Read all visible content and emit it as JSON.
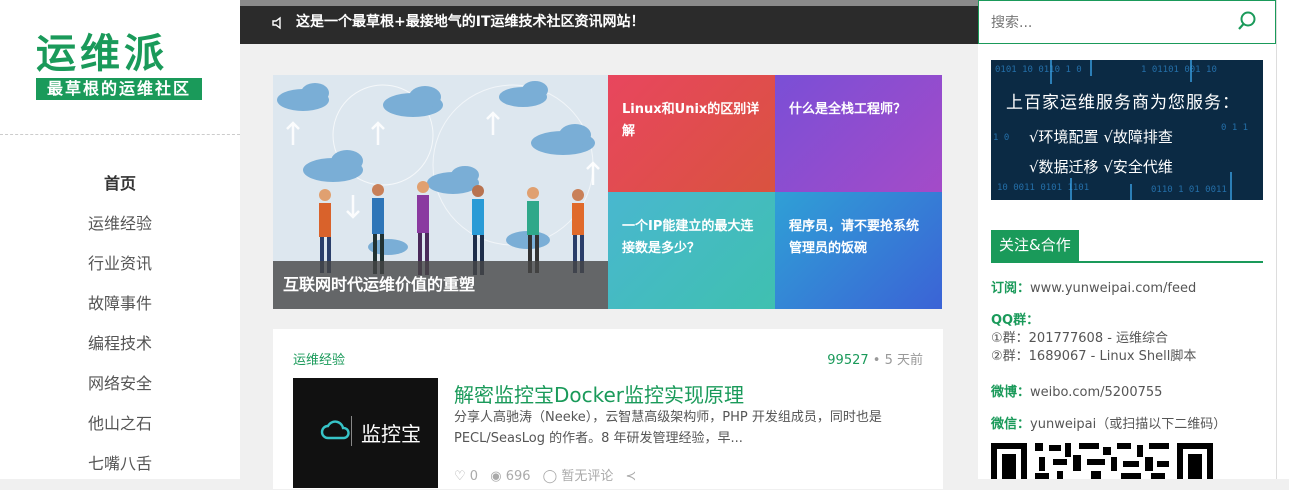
{
  "logo": {
    "title": "运维派",
    "subtitle": "最草根的运维社区"
  },
  "nav": [
    {
      "label": "首页",
      "active": true
    },
    {
      "label": "运维经验"
    },
    {
      "label": "行业资讯"
    },
    {
      "label": "故障事件"
    },
    {
      "label": "编程技术"
    },
    {
      "label": "网络安全"
    },
    {
      "label": "他山之石"
    },
    {
      "label": "七嘴八舌"
    }
  ],
  "notice": {
    "icon": "speaker-icon",
    "text": "这是一个最草根+最接地气的IT运维技术社区资讯网站！"
  },
  "search": {
    "placeholder": "搜索..."
  },
  "slider": {
    "main_caption": "互联网时代运维价值的重塑",
    "tiles": [
      {
        "text": "Linux和Unix的区别详解",
        "color": "#e14a5a"
      },
      {
        "text": "什么是全栈工程师？",
        "color": "#8a45c8"
      },
      {
        "text": "一个IP能建立的最大连接数是多少？",
        "color": "#3fb8c8"
      },
      {
        "text": "程序员，请不要抢系统管理员的饭碗",
        "color": "#3a6fd6"
      }
    ]
  },
  "article": {
    "category": "运维经验",
    "views": "99527",
    "time": "5 天前",
    "thumb_text": "监控宝",
    "title": "解密监控宝Docker监控实现原理",
    "desc": "分享人高驰涛（Neeke），云智慧高级架构师，PHP 开发组成员，同时也是PECL/SeasLog 的作者。8 年研发管理经验，早...",
    "likes": "0",
    "reads": "696",
    "comments": "暂无评论"
  },
  "ad": {
    "title": "上百家运维服务商为您服务：",
    "rows": [
      "√环境配置 √故障排查",
      "√数据迁移 √安全代维"
    ]
  },
  "follow": {
    "title": "关注&合作",
    "subscribe_label": "订阅：",
    "subscribe_value": "www.yunweipai.com/feed",
    "qq_label": "QQ群：",
    "qq1": "①群：201777608 - 运维综合",
    "qq2": "②群：1689067 - Linux Shell脚本",
    "weibo_label": "微博：",
    "weibo_value": "weibo.com/5200755",
    "wechat_label": "微信：",
    "wechat_value": "yunweipai（或扫描以下二维码）"
  },
  "colors": {
    "brand": "#1a9a5a",
    "notice_bg": "#2b2b2b"
  }
}
